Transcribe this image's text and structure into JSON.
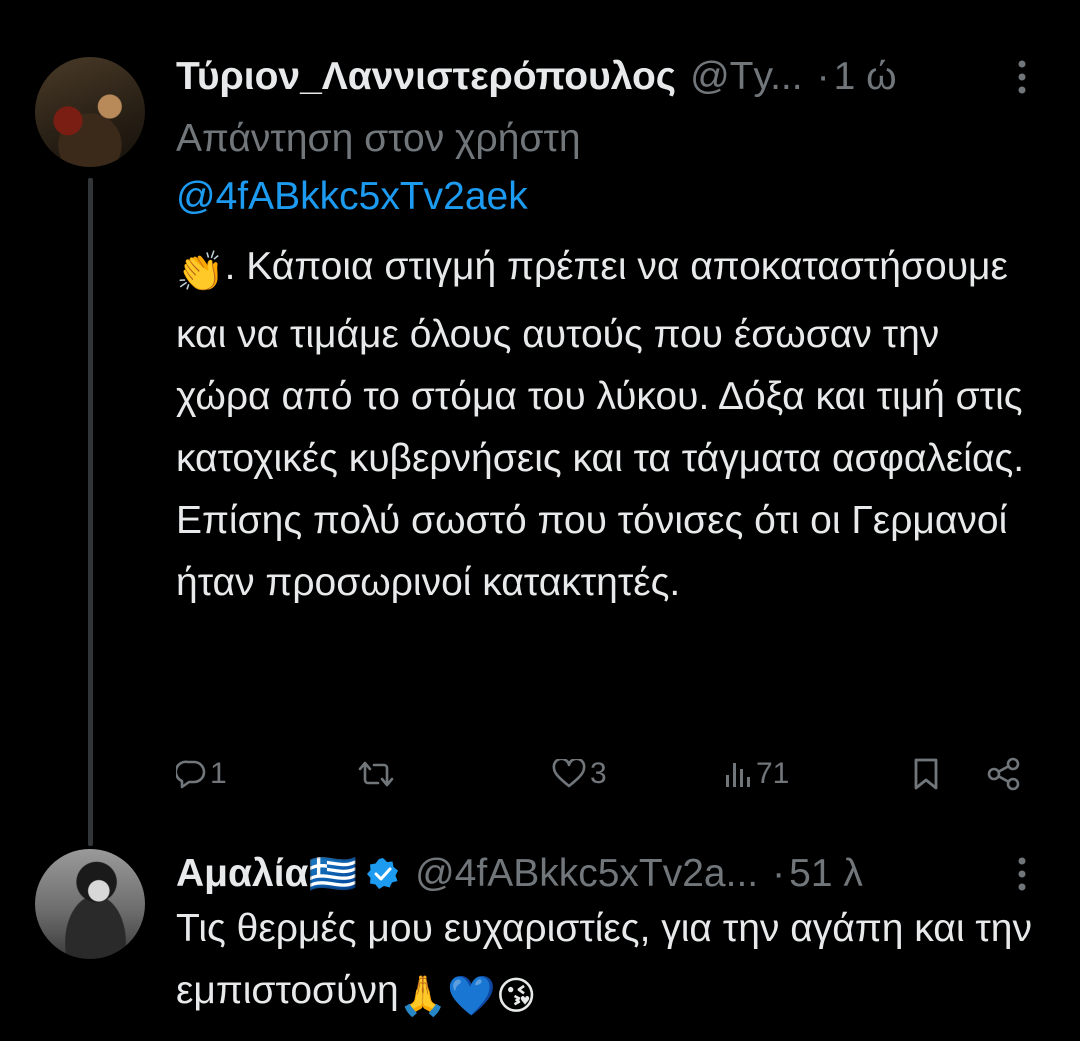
{
  "tweet": {
    "display_name": "Τύριον_Λαννιστερόπουλος",
    "handle": "@Τy...",
    "separator": "·",
    "time": "1 ώ",
    "reply_prefix": "Απάντηση στον χρήστη",
    "reply_mention": "@4fABkkc5xTv2aek",
    "text_emoji": "👏",
    "text": ". Κάποια στιγμή πρέπει να αποκαταστήσουμε και να τιμάμε όλους αυτούς που έσωσαν την χώρα από το στόμα του λύκου. Δόξα και τιμή στις κατοχικές κυβερνήσεις και τα τάγματα ασφαλείας. Επίσης πολύ σωστό που τόνισες ότι οι Γερμανοί ήταν προσωρινοί κατακτητές.",
    "replies_count": "1",
    "retweets_count": "",
    "likes_count": "3",
    "views_count": "71"
  },
  "reply": {
    "display_name": "Αμαλία",
    "flag_emoji": "🇬🇷",
    "handle": "@4fABkkc5xTv2a...",
    "separator": "·",
    "time": "51 λ",
    "text": "Τις θερμές μου ευχαριστίες, για την αγάπη και την εμπιστοσύνη",
    "text_emojis": "🙏💙😘"
  },
  "colors": {
    "background": "#000000",
    "text_primary": "#e7e9ea",
    "text_secondary": "#71767b",
    "link": "#1d9bf0",
    "verified_badge": "#1d9bf0",
    "thread_line": "#333639"
  },
  "icons": {
    "reply": "comment-bubble-icon",
    "retweet": "retweet-icon",
    "like": "heart-icon",
    "views": "bar-chart-icon",
    "bookmark": "bookmark-icon",
    "share": "share-icon",
    "more": "vertical-dots-icon",
    "verified": "verified-badge-icon"
  }
}
